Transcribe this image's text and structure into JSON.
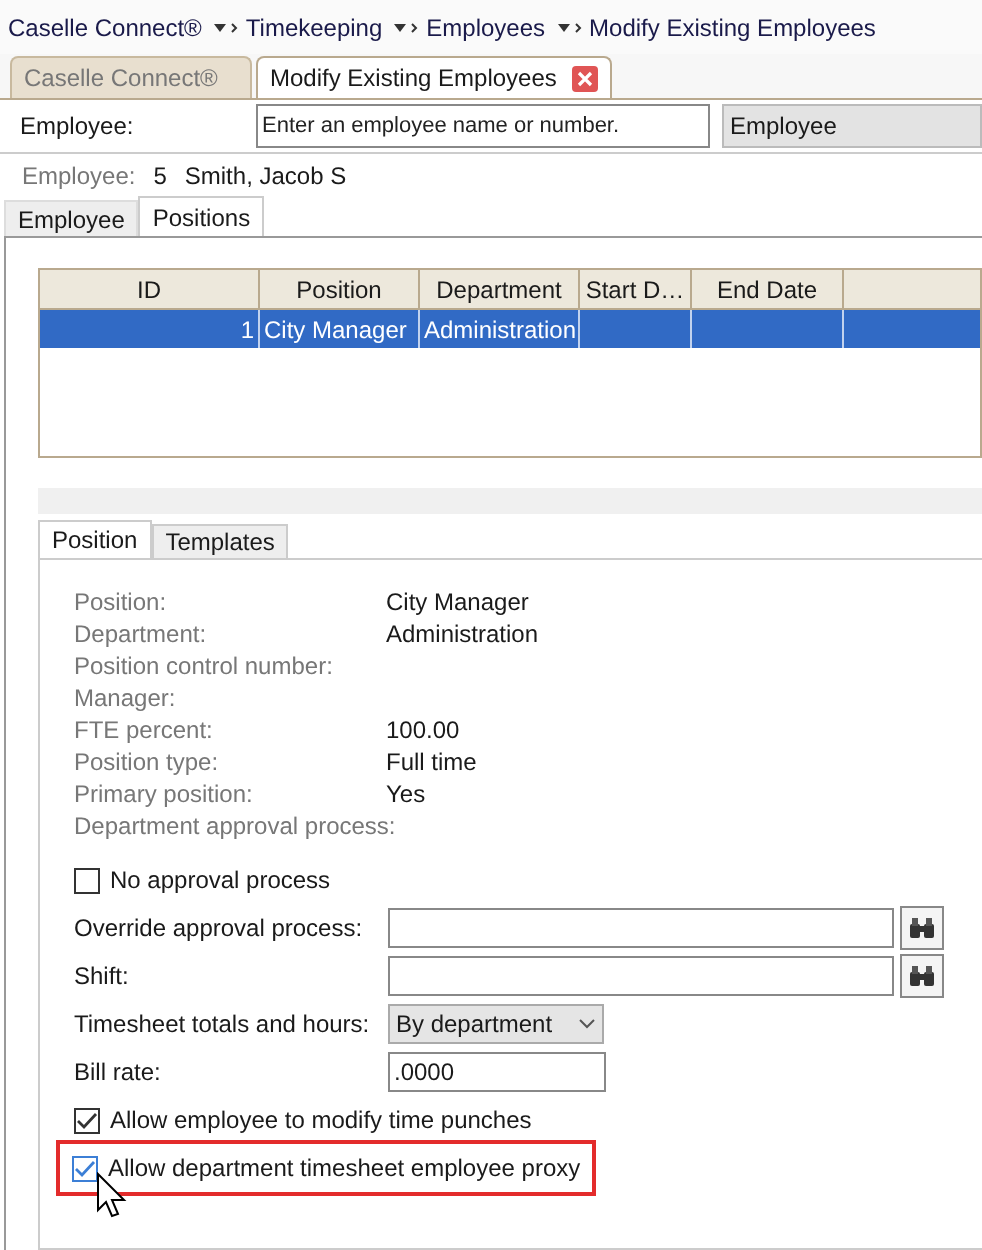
{
  "breadcrumbs": [
    {
      "label": "Caselle Connect®",
      "has_menu": true
    },
    {
      "label": "Timekeeping",
      "has_menu": true
    },
    {
      "label": "Employees",
      "has_menu": true
    },
    {
      "label": "Modify Existing Employees",
      "has_menu": false
    }
  ],
  "tabs": [
    {
      "label": "Caselle Connect®",
      "selected": false,
      "closable": false
    },
    {
      "label": "Modify Existing Employees",
      "selected": true,
      "closable": true
    }
  ],
  "search": {
    "label": "Employee:",
    "placeholder": "Enter an employee name or number.",
    "mode": "Employee"
  },
  "employee": {
    "label": "Employee:",
    "number": "5",
    "name": "Smith, Jacob S"
  },
  "subtabs": [
    {
      "label": "Employee",
      "selected": false
    },
    {
      "label": "Positions",
      "selected": true
    }
  ],
  "grid": {
    "columns": [
      "ID",
      "Position",
      "Department",
      "Start D…",
      "End Date"
    ],
    "rows": [
      {
        "cells": [
          "1",
          "City Manager",
          "Administration"
        ],
        "selected": true
      }
    ]
  },
  "detail_tabs": [
    {
      "label": "Position",
      "selected": true
    },
    {
      "label": "Templates",
      "selected": false
    }
  ],
  "details": [
    {
      "label": "Position:",
      "value": "City Manager"
    },
    {
      "label": "Department:",
      "value": "Administration"
    },
    {
      "label": "Position control number:"
    },
    {
      "label": "Manager:"
    },
    {
      "label": "FTE percent:",
      "value": "100.00"
    },
    {
      "label": "Position type:",
      "value": "Full time"
    },
    {
      "label": "Primary position:",
      "value": "Yes"
    },
    {
      "label": "Department approval process:"
    }
  ],
  "controls": [
    {
      "kind": "checkbox",
      "label": "No approval process",
      "checked": false,
      "highlighted": false
    },
    {
      "kind": "lookup",
      "label": "Override approval process:"
    },
    {
      "kind": "lookup",
      "label": "Shift:"
    },
    {
      "kind": "select",
      "label": "Timesheet totals and hours:",
      "value": "By department"
    },
    {
      "kind": "text",
      "label": "Bill rate:",
      "value": ".0000"
    },
    {
      "kind": "checkbox",
      "label": "Allow employee to modify time punches",
      "checked": true,
      "highlighted": false
    },
    {
      "kind": "checkbox",
      "label": "Allow department timesheet employee proxy",
      "checked": true,
      "highlighted": true
    }
  ]
}
